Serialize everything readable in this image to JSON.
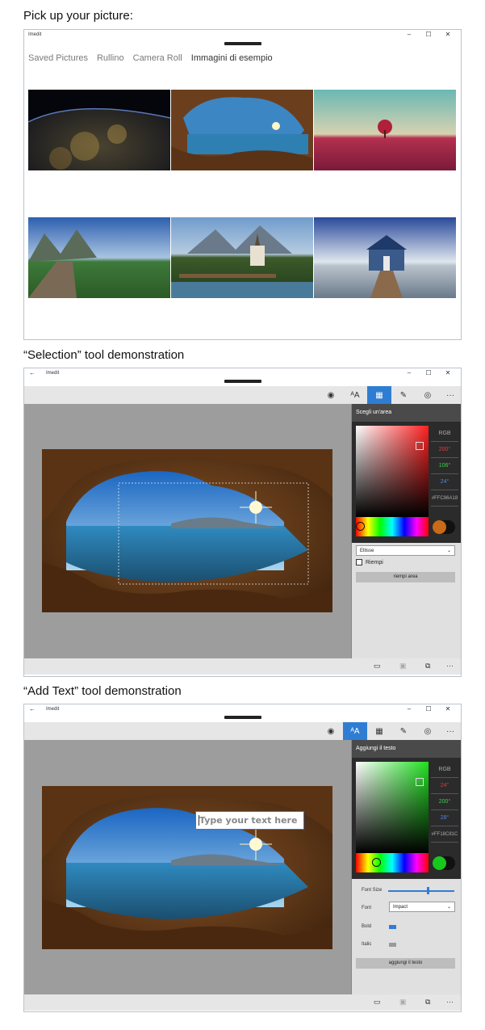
{
  "headings": {
    "pick": "Pick up your picture:",
    "selection": "“Selection” tool demonstration",
    "addtext": "“Add Text” tool demonstration"
  },
  "window": {
    "title": "Imedit",
    "back_icon": "back-arrow-icon",
    "minimize": "–",
    "maximize": "☐",
    "close": "✕"
  },
  "picker": {
    "tabs": [
      {
        "label": "Saved Pictures",
        "selected": false
      },
      {
        "label": "Rullino",
        "selected": false
      },
      {
        "label": "Camera Roll",
        "selected": false
      },
      {
        "label": "Immagini di esempio",
        "selected": true
      }
    ],
    "thumbnails": [
      {
        "name": "earth-night-lights"
      },
      {
        "name": "cave-sea-sunset"
      },
      {
        "name": "red-tree-field"
      },
      {
        "name": "boardwalk-mountains"
      },
      {
        "name": "alpine-chapel-bridge"
      },
      {
        "name": "blue-boathouse-pier"
      }
    ]
  },
  "toolbar": {
    "icons": [
      "eye-icon",
      "text-style-icon",
      "selection-icon",
      "pen-icon",
      "record-icon",
      "more-icon"
    ],
    "more": "···"
  },
  "selection_demo": {
    "panel_title": "Scegli un'area",
    "rgb_label": "RGB",
    "r": "200",
    "g": "106",
    "b": "24",
    "degree": "°",
    "hex": "#FFC86A18",
    "accent": "#c86a18",
    "shape_value": "Ellisse",
    "fill_label": "Riempi",
    "fill_button": "riempi area"
  },
  "text_demo": {
    "panel_title": "Aggiungi il testo",
    "rgb_label": "RGB",
    "r": "24",
    "g": "200",
    "b": "28",
    "degree": "°",
    "hex": "#FF18C81C",
    "accent": "#18c81c",
    "font_size_label": "Font Size",
    "font_label": "Font",
    "font_value": "Impact",
    "bold_label": "Bold",
    "italic_label": "Italic",
    "add_button": "aggiungi il testo",
    "placeholder": "Type your text here",
    "font_size_fraction": 0.6,
    "bold_on": true,
    "italic_on": false
  },
  "bottom_icons": [
    "present-icon",
    "save-icon",
    "crop-icon",
    "more-icon"
  ],
  "more_text": "···"
}
